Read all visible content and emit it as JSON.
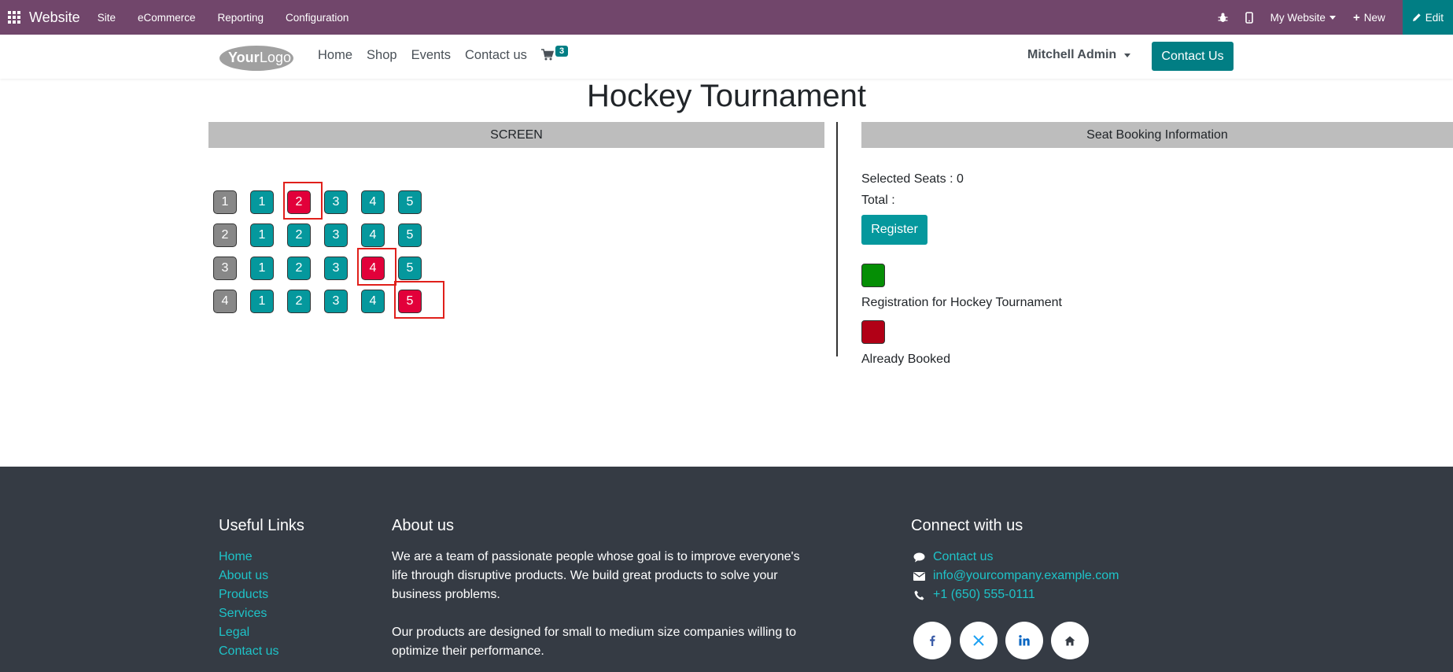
{
  "admin_bar": {
    "brand": "Website",
    "menu": [
      "Site",
      "eCommerce",
      "Reporting",
      "Configuration"
    ],
    "website_selector": "My Website",
    "new_label": "New",
    "edit_label": "Edit",
    "bg_color": "#71466b"
  },
  "header": {
    "logo_text": "YourLogo",
    "nav": [
      "Home",
      "Shop",
      "Events",
      "Contact us"
    ],
    "cart_count": "3",
    "user_name": "Mitchell Admin",
    "contact_button": "Contact Us",
    "accent_color": "#017e84"
  },
  "main": {
    "title": "Hockey Tournament",
    "screen_label": "SCREEN",
    "info_label": "Seat Booking Information",
    "seat_rows": [
      {
        "row": "1",
        "seats": [
          {
            "n": "1",
            "status": "available"
          },
          {
            "n": "2",
            "status": "booked",
            "highlighted": true
          },
          {
            "n": "3",
            "status": "available"
          },
          {
            "n": "4",
            "status": "available"
          },
          {
            "n": "5",
            "status": "available"
          }
        ]
      },
      {
        "row": "2",
        "seats": [
          {
            "n": "1",
            "status": "available"
          },
          {
            "n": "2",
            "status": "available"
          },
          {
            "n": "3",
            "status": "available"
          },
          {
            "n": "4",
            "status": "available"
          },
          {
            "n": "5",
            "status": "available"
          }
        ]
      },
      {
        "row": "3",
        "seats": [
          {
            "n": "1",
            "status": "available"
          },
          {
            "n": "2",
            "status": "available"
          },
          {
            "n": "3",
            "status": "available"
          },
          {
            "n": "4",
            "status": "booked",
            "highlighted": true
          },
          {
            "n": "5",
            "status": "available"
          }
        ]
      },
      {
        "row": "4",
        "seats": [
          {
            "n": "1",
            "status": "available"
          },
          {
            "n": "2",
            "status": "available"
          },
          {
            "n": "3",
            "status": "available"
          },
          {
            "n": "4",
            "status": "available"
          },
          {
            "n": "5",
            "status": "booked",
            "highlighted": true
          }
        ]
      }
    ],
    "selected_seats": "Selected Seats : 0",
    "total": "Total :",
    "register_label": "Register",
    "legend": [
      {
        "label": "Registration for Hockey Tournament",
        "color": "#058e05"
      },
      {
        "label": "Already Booked",
        "color": "#b10016"
      }
    ]
  },
  "footer": {
    "useful_links_title": "Useful Links",
    "useful_links": [
      "Home",
      "About us",
      "Products",
      "Services",
      "Legal",
      "Contact us"
    ],
    "about_title": "About us",
    "about_lines_1": [
      "We are a team of passionate people whose goal is to improve everyone's",
      "life through disruptive products. We build great products to solve your",
      "business problems."
    ],
    "about_lines_2": [
      "Our products are designed for small to medium size companies willing to",
      "optimize their performance."
    ],
    "connect_title": "Connect with us",
    "contact_link": "Contact us",
    "email": "info@yourcompany.example.com",
    "phone": "+1 (650) 555-0111",
    "social": [
      "facebook-icon",
      "x-icon",
      "linkedin-icon",
      "home-icon"
    ]
  }
}
